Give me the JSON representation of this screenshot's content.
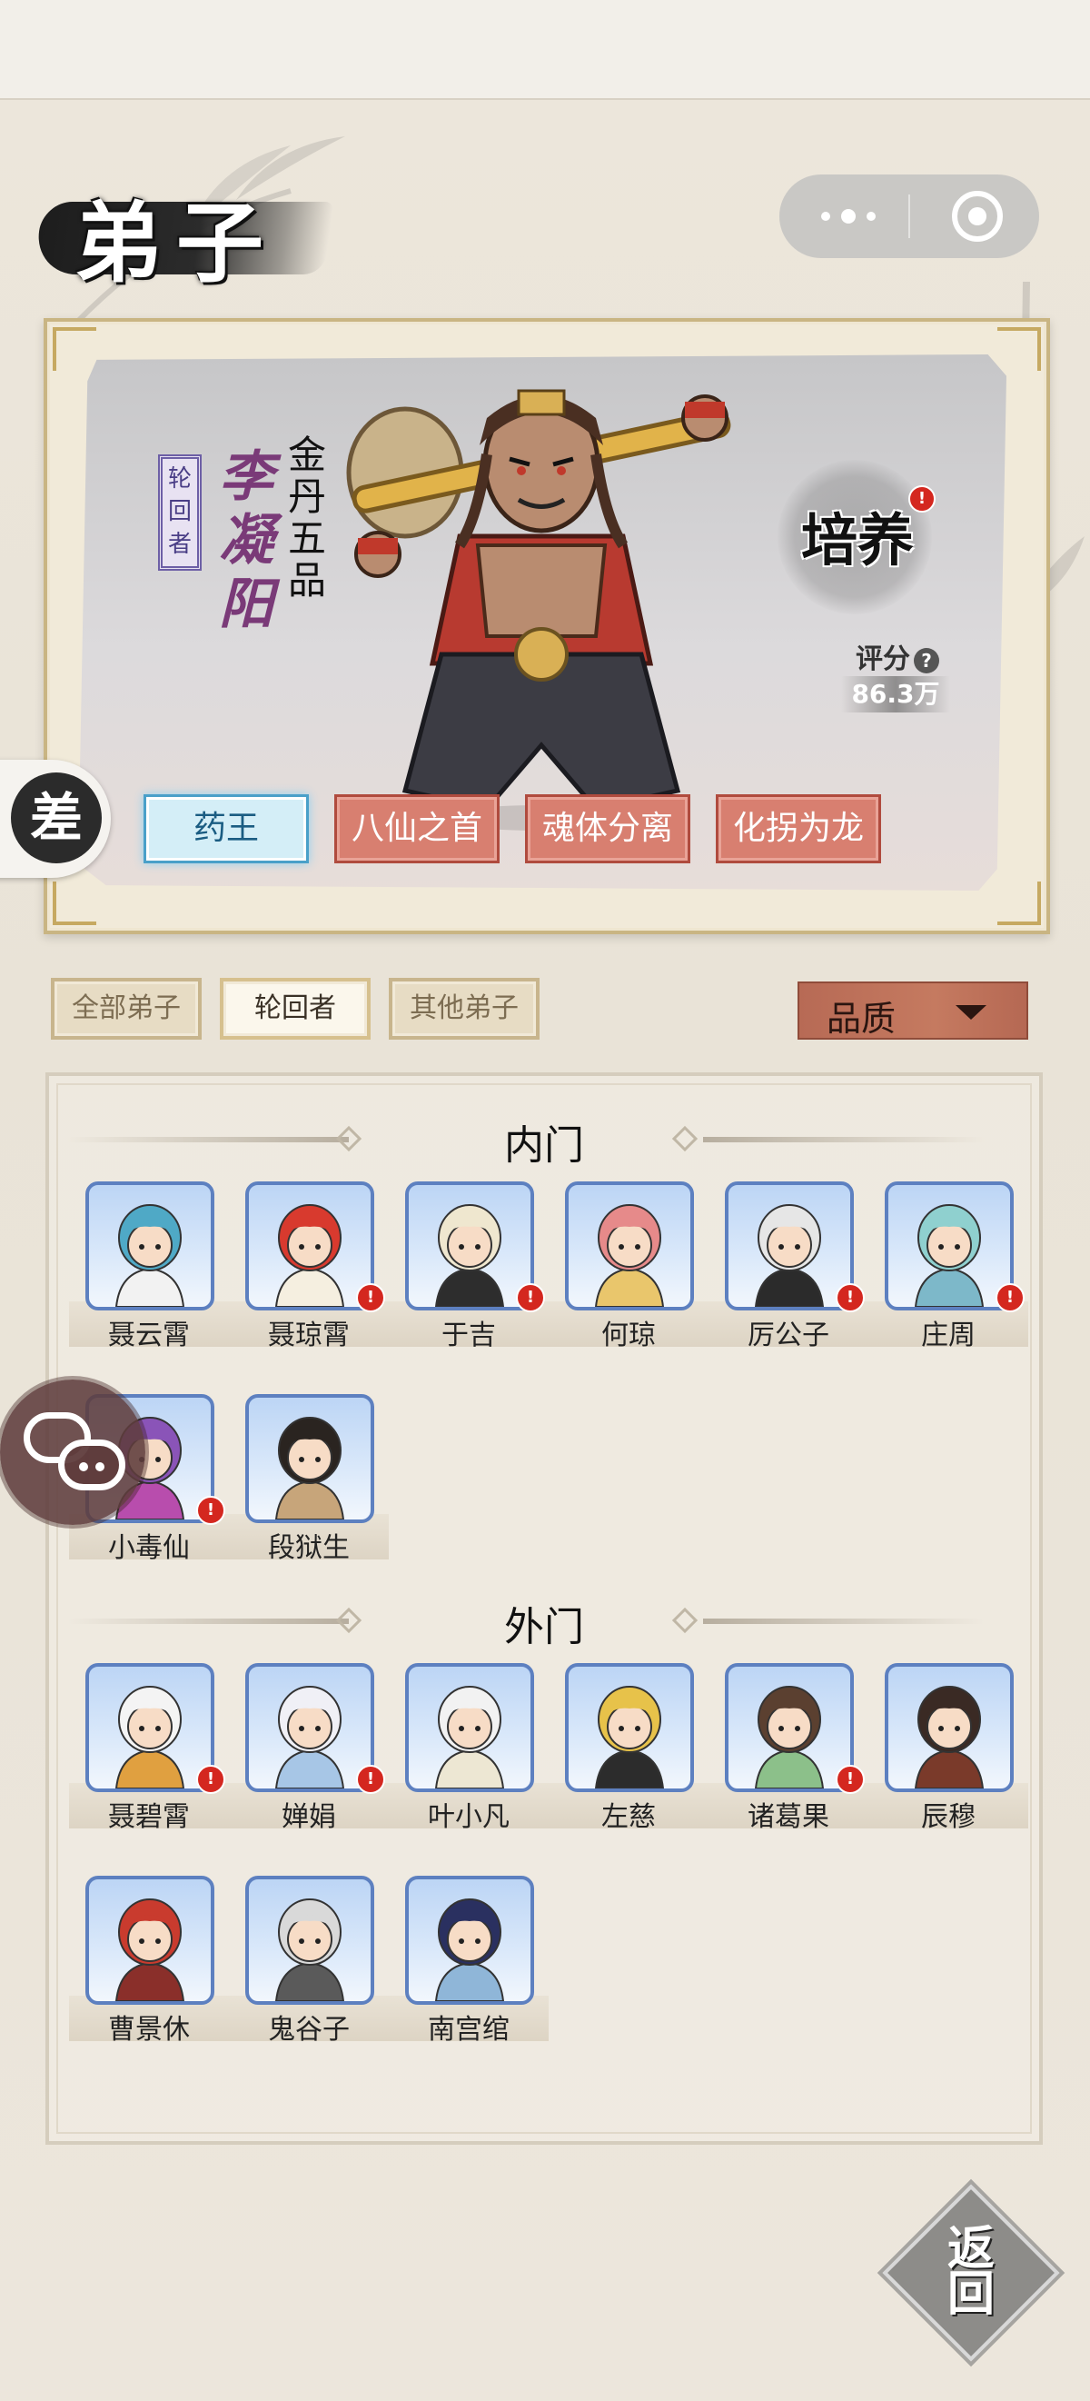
{
  "page_title": "弟子",
  "hero": {
    "badge": "轮回者",
    "name": "李凝阳",
    "rank": "金丹五品",
    "cultivate_label": "培养",
    "cultivate_alert": "!",
    "score_label": "评分",
    "score_help": "?",
    "score_value": "86.3万",
    "skills": [
      "药王",
      "八仙之首",
      "魂体分离",
      "化拐为龙"
    ],
    "selected_skill": 0
  },
  "float": {
    "cha_label": "差"
  },
  "filters": {
    "tabs": [
      "全部弟子",
      "轮回者",
      "其他弟子"
    ],
    "selected": 1,
    "quality_label": "品质"
  },
  "sections": [
    {
      "title": "内门",
      "members": [
        {
          "name": "聂云霄",
          "alert": false,
          "hair": "#4fa9c6",
          "cloth": "#f2f2f2"
        },
        {
          "name": "聂琼霄",
          "alert": true,
          "hair": "#d83a2e",
          "cloth": "#f5efe0"
        },
        {
          "name": "于吉",
          "alert": true,
          "hair": "#efe7cf",
          "cloth": "#2d2d2d"
        },
        {
          "name": "何琼",
          "alert": false,
          "hair": "#e68a8a",
          "cloth": "#e9c66c"
        },
        {
          "name": "厉公子",
          "alert": true,
          "hair": "#e6e6e6",
          "cloth": "#2b2b2b"
        },
        {
          "name": "庄周",
          "alert": true,
          "hair": "#8fd0cf",
          "cloth": "#7db8c9"
        },
        {
          "name": "小毒仙",
          "alert": true,
          "hair": "#8a54b8",
          "cloth": "#b84dad"
        },
        {
          "name": "段狱生",
          "alert": false,
          "hair": "#2a2420",
          "cloth": "#c7a57a"
        }
      ]
    },
    {
      "title": "外门",
      "members": [
        {
          "name": "聂碧霄",
          "alert": true,
          "hair": "#f4f4f4",
          "cloth": "#e0a040"
        },
        {
          "name": "婵娟",
          "alert": true,
          "hair": "#f0f0f6",
          "cloth": "#a7c6e6"
        },
        {
          "name": "叶小凡",
          "alert": false,
          "hair": "#f2f2f2",
          "cloth": "#ede7d3"
        },
        {
          "name": "左慈",
          "alert": false,
          "hair": "#e7c24a",
          "cloth": "#2c2c2c"
        },
        {
          "name": "诸葛果",
          "alert": true,
          "hair": "#5b4030",
          "cloth": "#8cc08a"
        },
        {
          "name": "辰穆",
          "alert": false,
          "hair": "#3a2a24",
          "cloth": "#7a3a2a"
        },
        {
          "name": "曹景休",
          "alert": false,
          "hair": "#c93b2e",
          "cloth": "#8a2f2a"
        },
        {
          "name": "鬼谷子",
          "alert": false,
          "hair": "#d9d9d9",
          "cloth": "#5a5a5a"
        },
        {
          "name": "南宫绾",
          "alert": false,
          "hair": "#2a3060",
          "cloth": "#8fb6d8"
        }
      ]
    }
  ],
  "back_label": "返回",
  "colors": {
    "accent_red": "#d87f70",
    "alert_red": "#d4271f",
    "portrait_border": "#5d80c0",
    "selected_skill": "#d4eef7"
  }
}
